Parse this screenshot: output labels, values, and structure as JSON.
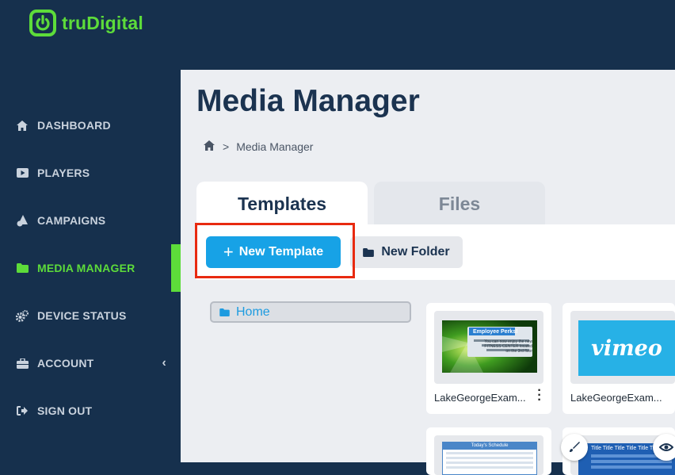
{
  "brand": {
    "name": "truDigital",
    "accent": "#5ddc3a"
  },
  "sidebar": {
    "items": [
      {
        "label": "DASHBOARD",
        "icon": "home-icon"
      },
      {
        "label": "PLAYERS",
        "icon": "play-icon"
      },
      {
        "label": "CAMPAIGNS",
        "icon": "campaigns-icon"
      },
      {
        "label": "MEDIA MANAGER",
        "icon": "folder-icon",
        "active": true
      },
      {
        "label": "DEVICE STATUS",
        "icon": "gears-icon"
      },
      {
        "label": "ACCOUNT",
        "icon": "briefcase-icon",
        "chevron": "‹"
      },
      {
        "label": "SIGN OUT",
        "icon": "sign-out-icon"
      }
    ]
  },
  "page": {
    "title": "Media Manager",
    "breadcrumb": {
      "separator": ">",
      "current": "Media Manager"
    }
  },
  "tabs": [
    {
      "label": "Templates",
      "active": true
    },
    {
      "label": "Files",
      "active": false
    }
  ],
  "toolbar": {
    "new_template": "New Template",
    "new_template_plus": "+",
    "new_folder": "New Folder"
  },
  "folders": [
    {
      "label": "Home"
    }
  ],
  "media": [
    {
      "name": "LakeGeorgeExam...",
      "thumb": "employee-perks-template",
      "thumb_title": "Employee Perks!",
      "thumb_text": "You can now enjoy the new FITNESS CENTER located on the 3rd floor"
    },
    {
      "name": "LakeGeorgeExam...",
      "thumb": "vimeo-logo",
      "thumb_title": "vimeo"
    },
    {
      "name": "",
      "thumb": "todays-schedule-template",
      "thumb_title": "Today's Schedule"
    },
    {
      "name": "",
      "thumb": "title-table-template",
      "thumb_title": "Title Title Title Title Title Title"
    }
  ],
  "colors": {
    "sidebar_bg": "#16304d",
    "primary_button": "#17a2e6",
    "highlight_border": "#e82a10"
  }
}
